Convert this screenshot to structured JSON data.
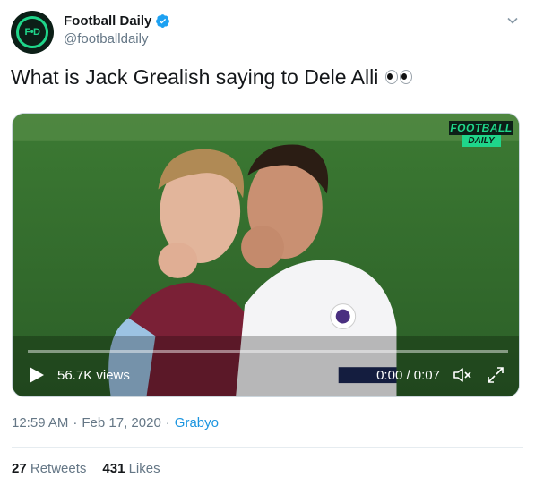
{
  "author": {
    "name": "Football Daily",
    "handle": "@footballdaily",
    "avatar_text": "F•D",
    "brand_color": "#1fd68a"
  },
  "tweet": {
    "text": "What is Jack Grealish saying to Dele Alli",
    "emoji": "eyes-icon"
  },
  "video": {
    "watermark_line1": "FOOTBALL",
    "watermark_line2": "DAILY",
    "views": "56.7K views",
    "time": "0:00 / 0:07",
    "progress": 0
  },
  "meta": {
    "time": "12:59 AM",
    "sep1": "·",
    "date": "Feb 17, 2020",
    "sep2": "·",
    "source": "Grabyo"
  },
  "stats": {
    "retweets_count": "27",
    "retweets_label": "Retweets",
    "likes_count": "431",
    "likes_label": "Likes"
  },
  "colors": {
    "link": "#1b95e0",
    "muted": "#657786",
    "verified": "#1da1f2"
  }
}
